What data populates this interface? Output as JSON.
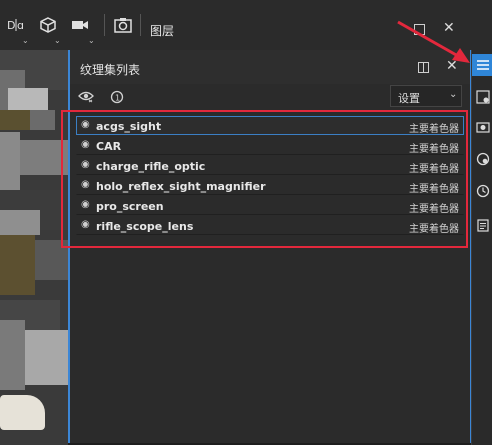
{
  "toolbar": {
    "layers_label": "图层",
    "icons": [
      "mirror-icon",
      "cube-icon",
      "camera-icon",
      "screenshot-icon"
    ]
  },
  "panel": {
    "title": "纹理集列表",
    "settings_label": "设置",
    "icons": [
      "split-view-icon",
      "close-icon",
      "visibility-toggle-icon",
      "info-icon"
    ]
  },
  "texture_sets": [
    {
      "name": "acgs_sight",
      "shader": "主要着色器"
    },
    {
      "name": "CAR",
      "shader": "主要着色器"
    },
    {
      "name": "charge_rifle_optic",
      "shader": "主要着色器"
    },
    {
      "name": "holo_reflex_sight_magnifier",
      "shader": "主要着色器"
    },
    {
      "name": "pro_screen",
      "shader": "主要着色器"
    },
    {
      "name": "rifle_scope_lens",
      "shader": "主要着色器"
    }
  ],
  "dock": {
    "icons": [
      "list-icon",
      "settings-list-icon",
      "camera-settings-icon",
      "display-settings-icon",
      "history-icon",
      "clipboard-icon"
    ]
  },
  "colors": {
    "accent": "#3b86d6",
    "highlight": "#e3283c"
  }
}
